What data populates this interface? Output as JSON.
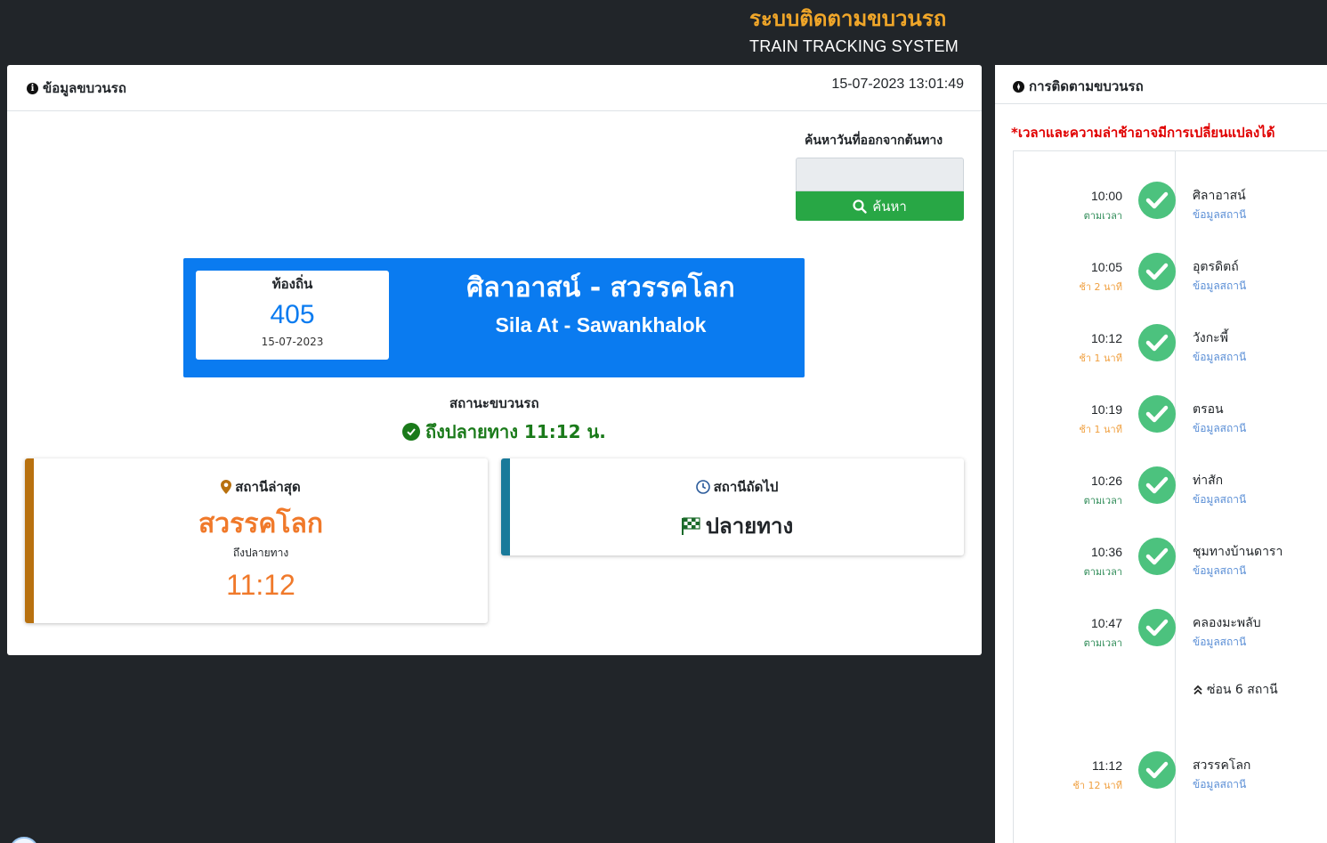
{
  "header": {
    "title_th": "ระบบติดตามขบวนรถ",
    "title_en": "TRAIN TRACKING SYSTEM"
  },
  "left_panel": {
    "title": "ข้อมูลขบวนรถ",
    "datetime": "15-07-2023 13:01:49",
    "search": {
      "label": "ค้นหาวันที่ออกจากต้นทาง",
      "input_value": "",
      "button_label": "ค้นหา"
    },
    "train": {
      "type": "ท้องถิ่น",
      "number": "405",
      "date": "15-07-2023",
      "route_th": "ศิลาอาสน์ - สวรรคโลก",
      "route_en": "Sila At - Sawankhalok"
    },
    "status": {
      "label": "สถานะขบวนรถ",
      "value": "ถึงปลายทาง 11:12 น."
    },
    "last_station": {
      "label": "สถานีล่าสุด",
      "name": "สวรรคโลก",
      "sub": "ถึงปลายทาง",
      "time": "11:12"
    },
    "next_station": {
      "label": "สถานีถัดไป",
      "name": "ปลายทาง"
    }
  },
  "right_panel": {
    "title": "การติดตามขบวนรถ",
    "warning": "*เวลาและความล่าช้าอาจมีการเปลี่ยนแปลงได้",
    "hide_label": "ซ่อน 6 สถานี",
    "stations": [
      {
        "time": "10:00",
        "status": "ตามเวลา",
        "status_type": "ontime",
        "name": "ศิลาอาสน์",
        "info": "ข้อมูลสถานี"
      },
      {
        "time": "10:05",
        "status": "ช้า 2 นาที",
        "status_type": "late",
        "name": "อุตรดิตถ์",
        "info": "ข้อมูลสถานี"
      },
      {
        "time": "10:12",
        "status": "ช้า 1 นาที",
        "status_type": "late",
        "name": "วังกะพี้",
        "info": "ข้อมูลสถานี"
      },
      {
        "time": "10:19",
        "status": "ช้า 1 นาที",
        "status_type": "late",
        "name": "ตรอน",
        "info": "ข้อมูลสถานี"
      },
      {
        "time": "10:26",
        "status": "ตามเวลา",
        "status_type": "ontime",
        "name": "ท่าสัก",
        "info": "ข้อมูลสถานี"
      },
      {
        "time": "10:36",
        "status": "ตามเวลา",
        "status_type": "ontime",
        "name": "ชุมทางบ้านดารา",
        "info": "ข้อมูลสถานี"
      },
      {
        "time": "10:47",
        "status": "ตามเวลา",
        "status_type": "ontime",
        "name": "คลองมะพลับ",
        "info": "ข้อมูลสถานี"
      },
      {
        "time": "11:12",
        "status": "ช้า 12 นาที",
        "status_type": "late",
        "name": "สวรรคโลก",
        "info": "ข้อมูลสถานี"
      }
    ]
  },
  "colors": {
    "header_accent": "#f0a629",
    "train_card": "#0a7bf0",
    "status_green": "#1a7a1a",
    "last_station_orange": "#f0792a",
    "timeline_check": "#4cc27e",
    "warning_red": "#e00000"
  },
  "icons": [
    "info-icon",
    "search-icon",
    "check-circle-icon",
    "map-marker-icon",
    "clock-icon",
    "checkered-flag-icon",
    "check-icon",
    "chevron-up-double-icon",
    "compass-icon"
  ]
}
